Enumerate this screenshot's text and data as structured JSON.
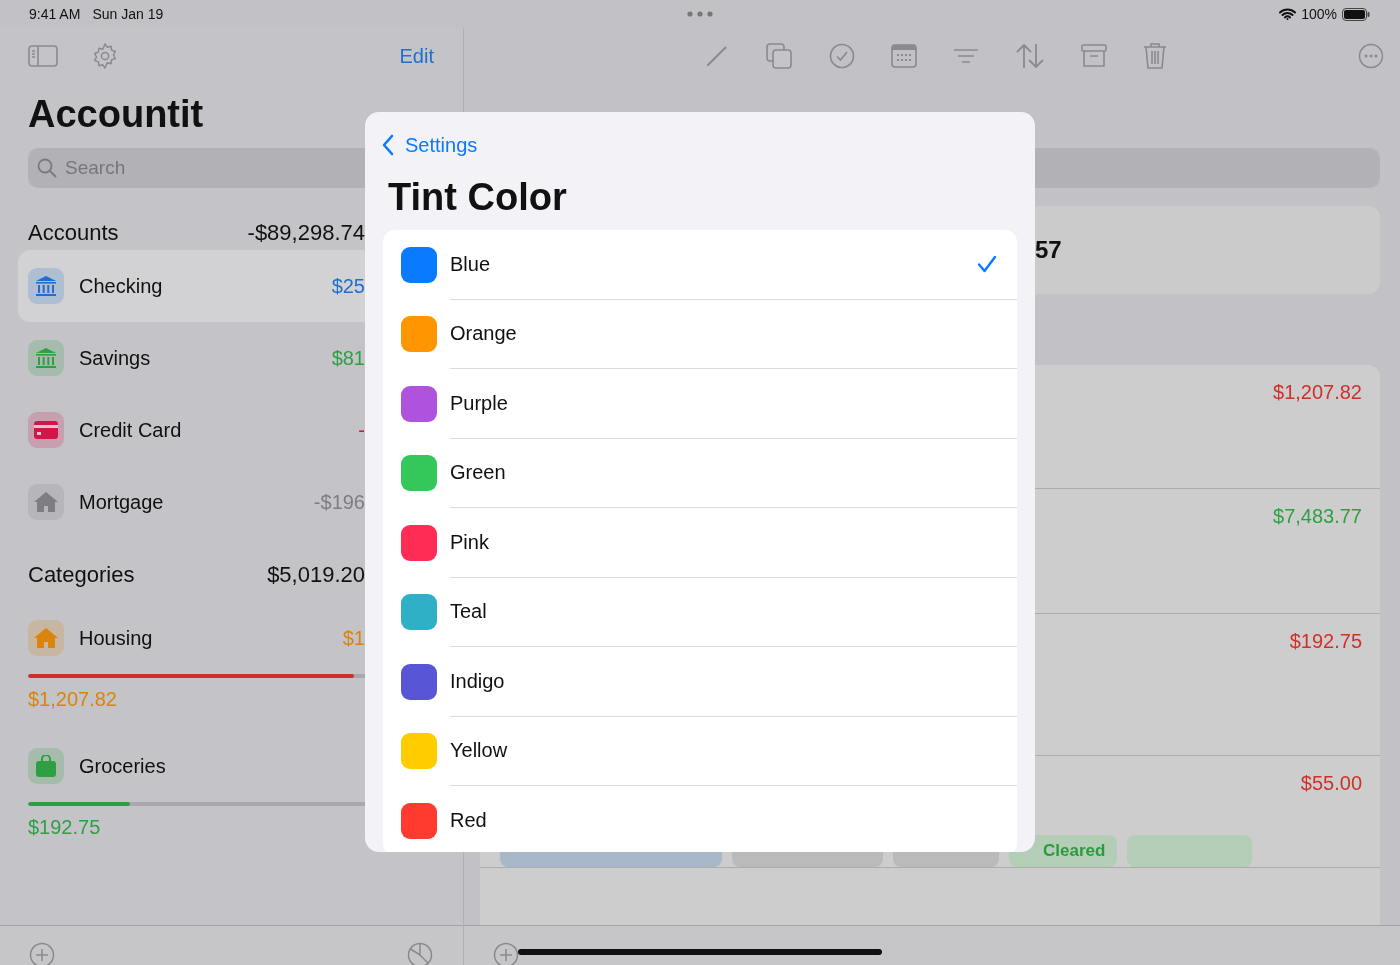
{
  "status_bar": {
    "time": "9:41 AM",
    "date": "Sun Jan 19",
    "battery": "100%"
  },
  "sidebar": {
    "edit": "Edit",
    "title": "Accountit",
    "search": {
      "placeholder": "Search"
    },
    "accounts": {
      "title": "Accounts",
      "total": "-$89,298.74",
      "items": [
        {
          "name": "Checking",
          "amount": "$25",
          "kind": "bank",
          "color": "#1f6fd1",
          "selected": true
        },
        {
          "name": "Savings",
          "amount": "$81",
          "kind": "bank",
          "color": "#2ea043",
          "selected": false
        },
        {
          "name": "Credit Card",
          "amount": "-",
          "kind": "card",
          "color": "#d0164a",
          "selected": false
        },
        {
          "name": "Mortgage",
          "amount": "-$196",
          "kind": "house",
          "color": "#7d7d82",
          "selected": false
        }
      ]
    },
    "categories": {
      "title": "Categories",
      "total": "$5,019.20",
      "items": [
        {
          "name": "Housing",
          "amount": "$1",
          "kind": "house",
          "color": "#d9840a",
          "over_budget": true,
          "level": 0.8,
          "spent": "$1,207.82"
        },
        {
          "name": "Groceries",
          "kind": "bag",
          "color": "#2ea043",
          "over_budget": false,
          "level": 0.25,
          "spent": "$192.75"
        }
      ]
    }
  },
  "detail": {
    "balance": "57",
    "transactions": [
      {
        "amount": "$1,207.82",
        "kind": "expense"
      },
      {
        "amount": "$7,483.77",
        "kind": "income"
      },
      {
        "amount": "$192.75",
        "kind": "expense"
      },
      {
        "amount": "$55.00",
        "kind": "expense",
        "tags": [
          {
            "kind": "date"
          },
          {
            "kind": "category"
          },
          {
            "kind": "repeat"
          },
          {
            "kind": "status",
            "label": "Cleared"
          },
          {
            "kind": "note"
          }
        ]
      }
    ]
  },
  "tint_sheet": {
    "back": "Settings",
    "title": "Tint Color",
    "colors": [
      {
        "name": "Blue",
        "color": "#0a7aff",
        "selected": true
      },
      {
        "name": "Orange",
        "color": "#ff9500",
        "selected": false
      },
      {
        "name": "Purple",
        "color": "#af52de",
        "selected": false
      },
      {
        "name": "Green",
        "color": "#34c759",
        "selected": false
      },
      {
        "name": "Pink",
        "color": "#ff2d55",
        "selected": false
      },
      {
        "name": "Teal",
        "color": "#30b0c7",
        "selected": false
      },
      {
        "name": "Indigo",
        "color": "#5856d6",
        "selected": false
      },
      {
        "name": "Yellow",
        "color": "#ffcc00",
        "selected": false
      },
      {
        "name": "Red",
        "color": "#ff3b30",
        "selected": false
      }
    ]
  }
}
